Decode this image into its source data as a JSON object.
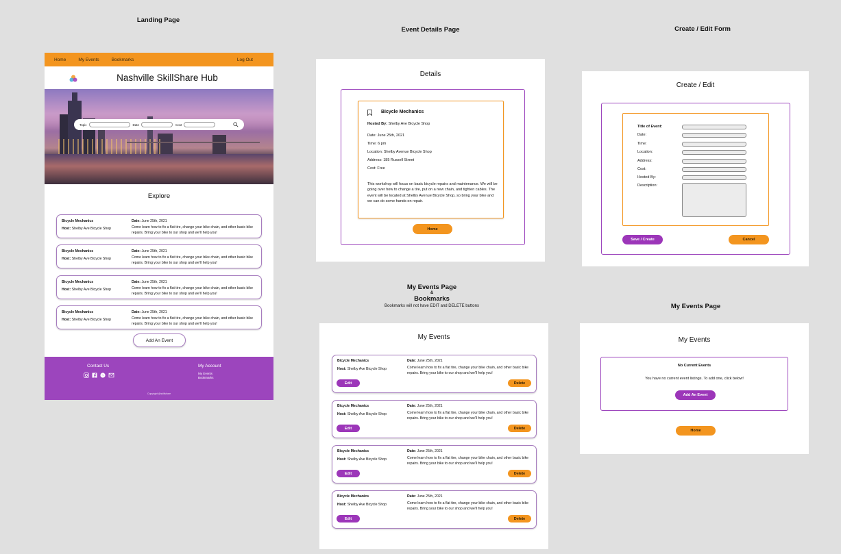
{
  "captions": {
    "landing": "Landing Page",
    "details": "Event Details Page",
    "create": "Create / Edit Form",
    "myevents_line1": "My Events Page",
    "myevents_amp": "&",
    "myevents_line2": "Bookmarks",
    "myevents_note": "Bookmarks will not have EDIT and DELETE buttons",
    "myempty": "My Events Page"
  },
  "landing": {
    "nav": {
      "home": "Home",
      "my_events": "My Events",
      "bookmarks": "Bookmarks",
      "logout": "Log Out"
    },
    "title": "Nashville SkillShare Hub",
    "search": {
      "topic": "Topic",
      "date": "Date",
      "cost": "Cost"
    },
    "explore": "Explore",
    "cards": [
      {
        "title": "Bicycle Mechanics",
        "host_label": "Host:",
        "host": "Shelby Ave Bicycle Shop",
        "date_label": "Date:",
        "date": "June 25th, 2021",
        "desc": "Come learn how to fix a flat tire, change your bike chain, and other basic bike repairs. Bring your bike to our shop and we'll help you!"
      },
      {
        "title": "Bicycle Mechanics",
        "host_label": "Host:",
        "host": "Shelby Ave Bicycle Shop",
        "date_label": "Date:",
        "date": "June 25th, 2021",
        "desc": "Come learn how to fix a flat tire, change your bike chain, and other basic bike repairs. Bring your bike to our shop and we'll help you!"
      },
      {
        "title": "Bicycle Mechanics",
        "host_label": "Host:",
        "host": "Shelby Ave Bicycle Shop",
        "date_label": "Date:",
        "date": "June 25th, 2021",
        "desc": "Come learn how to fix a flat tire, change your bike chain, and other basic bike repairs. Bring your bike to our shop and we'll help you!"
      },
      {
        "title": "Bicycle Mechanics",
        "host_label": "Host:",
        "host": "Shelby Ave Bicycle Shop",
        "date_label": "Date:",
        "date": "June 25th, 2021",
        "desc": "Come learn how to fix a flat tire, change your bike chain, and other basic bike repairs. Bring your bike to our shop and we'll help you!"
      }
    ],
    "add_event": "Add An Event",
    "footer": {
      "contact": "Contact Us",
      "account": "My Account",
      "links": [
        "My Events",
        "Bookmarks"
      ],
      "copyright": "Copyright @skillshare"
    }
  },
  "details": {
    "title": "Details",
    "event_title": "Bicycle Mechanics",
    "hosted_by_label": "Hosted By:",
    "hosted_by": "Shelby Ave Bicycle Shop",
    "date": "Date: June 25th, 2021",
    "time": "Time: 6 pm",
    "location": "Location: Shelby Avenue Bicycle Shop",
    "address": "Address: 185 Russell Street",
    "cost": "Cost: Free",
    "description": "This workshop will focus on basic bicycle repairs and maintenance. We will be going over how to change a tire, put on a new chain, and tighten cables. The event will be located at Shelby Avenue Bicycle Shop, so bring your bike and we can do some hands-on repair.",
    "home_button": "Home"
  },
  "create": {
    "title": "Create / Edit",
    "fields": [
      "Title of Event:",
      "Date:",
      "Time:",
      "Location:",
      "Address:",
      "Cost:",
      "Hosted By:",
      "Description:"
    ],
    "save_button": "Save / Create",
    "cancel_button": "Cancel"
  },
  "myevents": {
    "title": "My Events",
    "edit_label": "Edit",
    "delete_label": "Delete",
    "cards": [
      {
        "title": "Bicycle Mechanics",
        "host_label": "Host:",
        "host": "Shelby Ave Bicycle Shop",
        "date_label": "Date:",
        "date": "June 25th, 2021",
        "desc": "Come learn how to fix a flat tire, change your bike chain, and other basic bike repairs. Bring your bike to our shop and we'll help you!"
      },
      {
        "title": "Bicycle Mechanics",
        "host_label": "Host:",
        "host": "Shelby Ave Bicycle Shop",
        "date_label": "Date:",
        "date": "June 25th, 2021",
        "desc": "Come learn how to fix a flat tire, change your bike chain, and other basic bike repairs. Bring your bike to our shop and we'll help you!"
      },
      {
        "title": "Bicycle Mechanics",
        "host_label": "Host:",
        "host": "Shelby Ave Bicycle Shop",
        "date_label": "Date:",
        "date": "June 25th, 2021",
        "desc": "Come learn how to fix a flat tire, change your bike chain, and other basic bike repairs. Bring your bike to our shop and we'll help you!"
      },
      {
        "title": "Bicycle Mechanics",
        "host_label": "Host:",
        "host": "Shelby Ave Bicycle Shop",
        "date_label": "Date:",
        "date": "June 25th, 2021",
        "desc": "Come learn how to fix a flat tire, change your bike chain, and other basic bike repairs. Bring your bike to our shop and we'll help you!"
      }
    ]
  },
  "myempty": {
    "title": "My Events",
    "heading": "No Current Events",
    "message": "You have no current event listings. To add one, click below!",
    "add_button": "Add An Event",
    "home_button": "Home"
  },
  "colors": {
    "orange": "#f3951f",
    "purple": "#9c36b9",
    "footer_purple": "#9c45bd",
    "background": "#e0e0e0"
  }
}
